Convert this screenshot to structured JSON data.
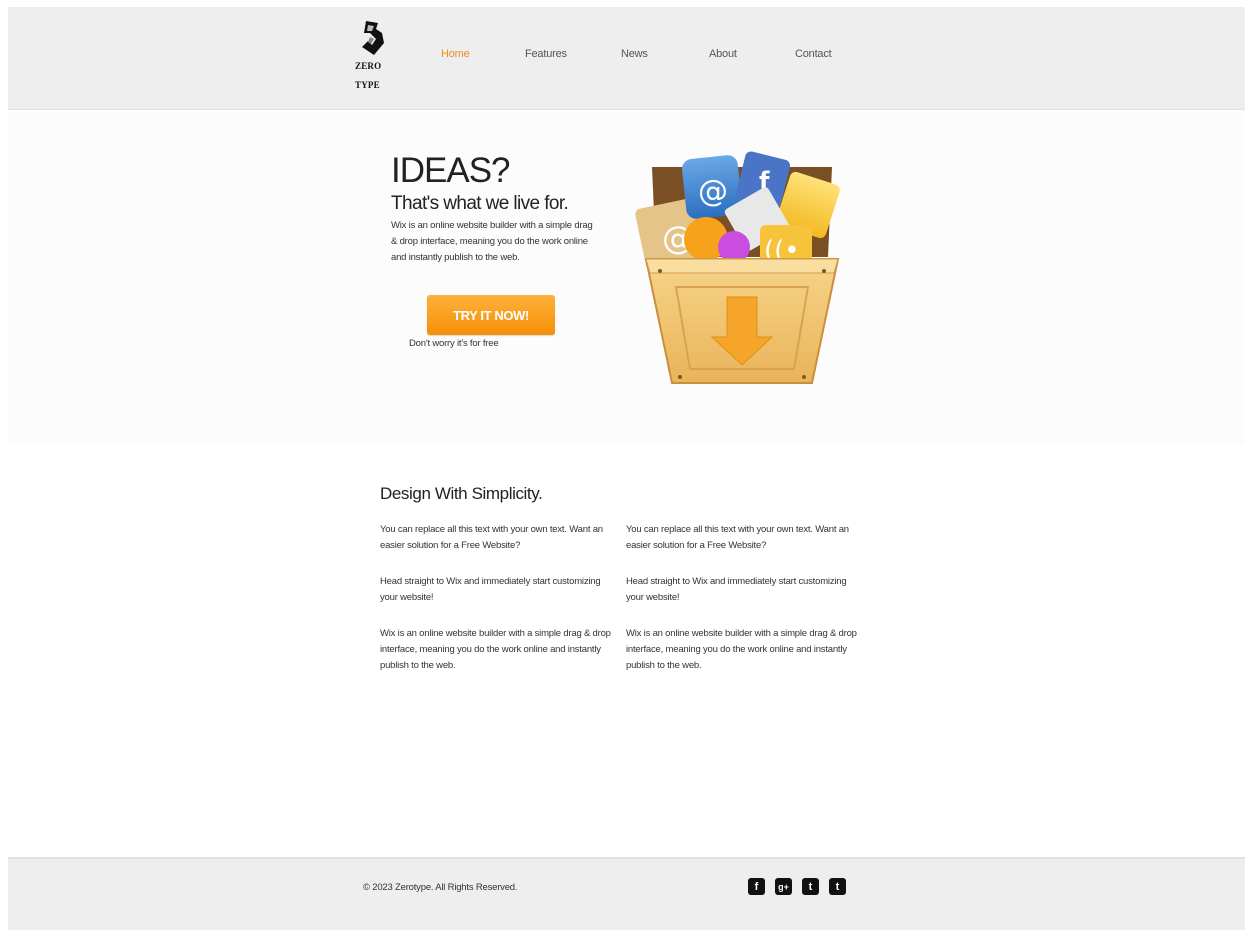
{
  "header": {
    "logo_line1": "ZERO",
    "logo_line2": "TYPE",
    "nav": [
      "Home",
      "Features",
      "News",
      "About",
      "Contact"
    ]
  },
  "hero": {
    "title": "IDEAS?",
    "subtitle": "That's what we live for.",
    "text": "Wix is an online website builder with a simple drag & drop interface, meaning you do the work online and instantly publish to the web.",
    "cta_label": "TRY IT NOW!",
    "cta_note": "Don't worry it's for free"
  },
  "content": {
    "title": "Design With Simplicity.",
    "columns": [
      {
        "p1": "You can replace all this text with your own text. Want an easier solution for a Free Website?",
        "p2": "Head straight to Wix and immediately start customizing your website!",
        "p3": "Wix is an online website builder with a simple drag & drop interface, meaning you do the work online and instantly publish to the web."
      },
      {
        "p1": "You can replace all this text with your own text. Want an easier solution for a Free Website?",
        "p2": "Head straight to Wix and immediately start customizing your website!",
        "p3": "Wix is an online website builder with a simple drag & drop interface, meaning you do the work online and instantly publish to the web."
      }
    ]
  },
  "footer": {
    "copyright": "© 2023 Zerotype. All Rights Reserved.",
    "social": [
      {
        "icon": "facebook-icon",
        "glyph": "f"
      },
      {
        "icon": "google-plus-icon",
        "glyph": "g+"
      },
      {
        "icon": "twitter-icon",
        "glyph": "t"
      },
      {
        "icon": "tumblr-icon",
        "glyph": "t"
      }
    ]
  },
  "colors": {
    "accent": "#f28a1e",
    "header_bg": "#eeeeee",
    "cta_top": "#fdb23a",
    "cta_bottom": "#f58f08"
  }
}
